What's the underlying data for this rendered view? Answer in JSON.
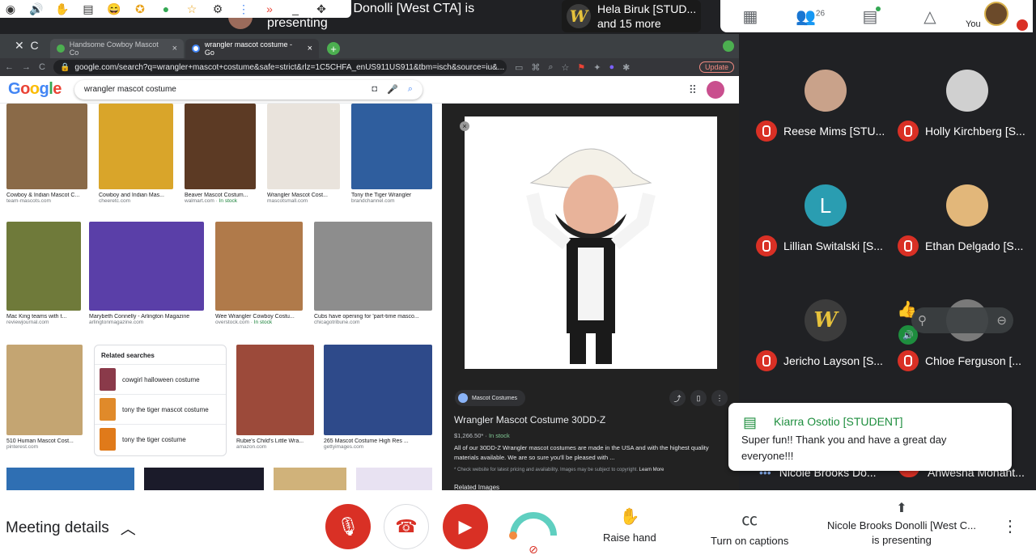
{
  "presenter_banner": {
    "line1": "s Donolli [West CTA] is",
    "line2": "presenting"
  },
  "hela": {
    "line1": "Hela Biruk [STUD...",
    "line2": "and 15 more"
  },
  "browser": {
    "tabs": [
      {
        "label": "Handsome Cowboy Mascot Co"
      },
      {
        "label": "wrangler mascot costume - Go"
      }
    ],
    "url": "google.com/search?q=wrangler+mascot+costume&safe=strict&rlz=1C5CHFA_enUS911US911&tbm=isch&source=iu&...",
    "update_label": "Update"
  },
  "google": {
    "logo_letters": [
      "G",
      "o",
      "o",
      "g",
      "l",
      "e"
    ],
    "query": "wrangler mascot costume"
  },
  "results": [
    {
      "title": "Cowboy & Indian Mascot C...",
      "source": "team-mascots.com",
      "stock": "",
      "color": "#8a6a48"
    },
    {
      "title": "Cowboy and Indian Mas...",
      "source": "cheeretc.com",
      "stock": "",
      "color": "#d9a52a"
    },
    {
      "title": "Beaver Mascot Costum...",
      "source": "walmart.com",
      "stock": "In stock",
      "color": "#5c3a24"
    },
    {
      "title": "Wrangler Mascot Cost...",
      "source": "mascotsmall.com",
      "stock": "",
      "color": "#e9e3dc"
    },
    {
      "title": "Tony the Tiger Wrangler",
      "source": "brandchannel.com",
      "stock": "",
      "color": "#2f5e9e"
    },
    {
      "title": "Mac King teams with t...",
      "source": "reviewjournal.com",
      "stock": "",
      "color": "#6f7a3a"
    },
    {
      "title": "Marybeth Connelly - Arlington Magazine",
      "source": "arlingtonmagazine.com",
      "stock": "",
      "color": "#5a3fa8"
    },
    {
      "title": "Wee Wrangler Cowboy Costu...",
      "source": "overstock.com",
      "stock": "In stock",
      "color": "#b07a4a"
    },
    {
      "title": "Cubs have opening for 'part-time masco...",
      "source": "chicagotribune.com",
      "stock": "",
      "color": "#8d8d8d"
    },
    {
      "title": "510 Human Mascot Cost...",
      "source": "pinterest.com",
      "stock": "",
      "color": "#c4a572"
    },
    {
      "title": "Rubie's Child's Little Wra...",
      "source": "amazon.com",
      "stock": "",
      "color": "#9c4a3a"
    },
    {
      "title": "265 Mascot Costume High Res ...",
      "source": "gettyimages.com",
      "stock": "",
      "color": "#2e4a8a"
    }
  ],
  "related": {
    "heading": "Related searches",
    "items": [
      {
        "label": "cowgirl halloween costume",
        "color": "#8a3a4a"
      },
      {
        "label": "tony the tiger mascot costume",
        "color": "#e08a2a"
      },
      {
        "label": "tony the tiger costume",
        "color": "#e07a1a"
      }
    ]
  },
  "preview": {
    "source_chip": "Mascot Costumes",
    "title": "Wrangler Mascot Costume 30DD-Z",
    "price": "$1,266.50*",
    "stock": "In stock",
    "desc": "All of our 30DD-Z Wrangler mascot costumes are made in the USA and with the highest quality materials available. We are so sure you'll be pleased with ...",
    "note": "* Check website for latest pricing and availability. Images may be subject to copyright.",
    "learn_more": "Learn More",
    "related_images": "Related Images"
  },
  "top_icons": {
    "participants_count": "26",
    "you_label": "You"
  },
  "participants": [
    {
      "name": "Reese Mims [STU...",
      "initial": "",
      "color": "#c9a28a"
    },
    {
      "name": "Holly Kirchberg [S...",
      "initial": "",
      "color": "#d0d0d0"
    },
    {
      "name": "Lillian Switalski [S...",
      "initial": "L",
      "color": "#2a9db1"
    },
    {
      "name": "Ethan Delgado [S...",
      "initial": "",
      "color": "#e2b77a"
    },
    {
      "name": "Jericho Layson [S...",
      "initial": "W",
      "color": "#3c3c3c"
    },
    {
      "name": "Chloe Ferguson [...",
      "initial": "",
      "color": "#7a7a7a"
    }
  ],
  "extra_rows": {
    "left": "Nicole Brooks Do...",
    "right": "Anwesha Mohant..."
  },
  "chat": {
    "sender": "Kiarra Osotio [STUDENT]",
    "message": "Super fun!! Thank you and have a great day everyone!!!"
  },
  "bottom": {
    "meeting_details": "Meeting details",
    "raise_hand": "Raise hand",
    "captions": "Turn on captions",
    "presenting_line1": "Nicole Brooks Donolli [West C...",
    "presenting_line2": "is presenting"
  }
}
